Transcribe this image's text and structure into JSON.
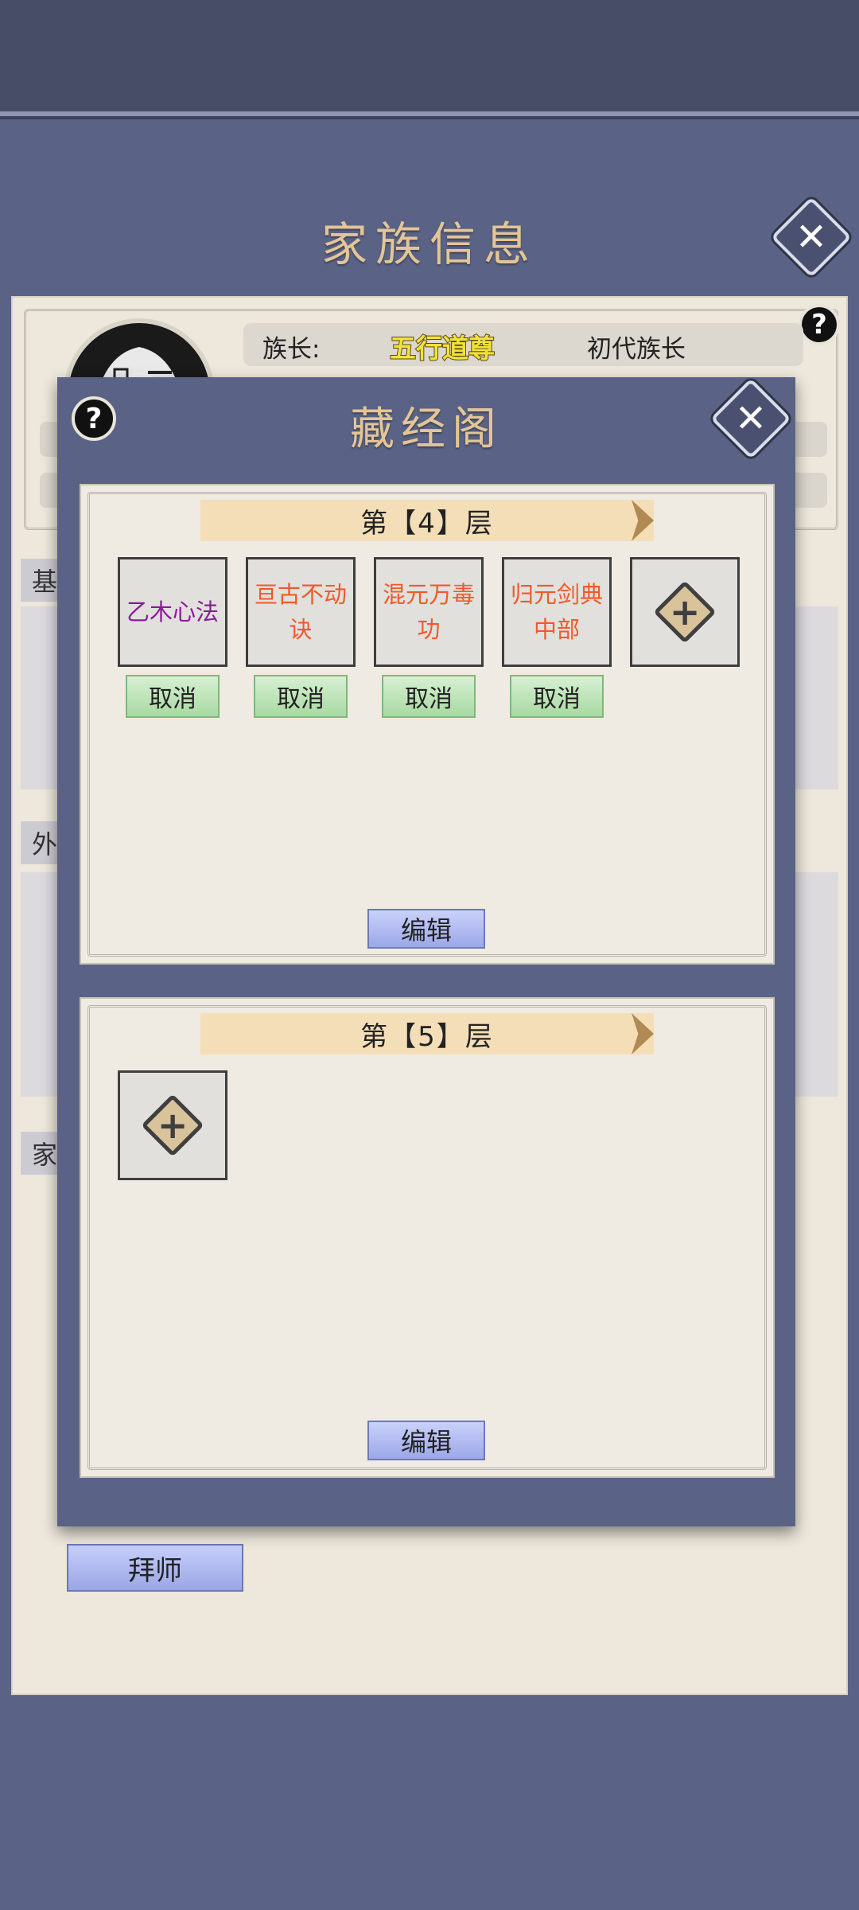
{
  "family_panel": {
    "title": "家族信息",
    "patriarch": {
      "label": "族长:",
      "name": "五行道尊",
      "title": "初代族长"
    },
    "sections": [
      "基",
      "外",
      "家"
    ],
    "bow_button": "拜师"
  },
  "pavilion": {
    "title": "藏经阁",
    "floors": [
      {
        "label": "第【4】层",
        "books": [
          {
            "name": "乙木心法",
            "color": "#8a1a9a"
          },
          {
            "name": "亘古不动诀",
            "color": "#ef5a2a"
          },
          {
            "name": "混元万毒功",
            "color": "#ef5a2a"
          },
          {
            "name": "归元剑典中部",
            "color": "#ef5a2a"
          }
        ],
        "cancel_label": "取消",
        "edit_label": "编辑"
      },
      {
        "label": "第【5】层",
        "books": [],
        "edit_label": "编辑"
      }
    ]
  },
  "icons": [
    "close-icon",
    "help-icon",
    "add-icon",
    "arrow-left-icon",
    "arrow-right-icon"
  ]
}
